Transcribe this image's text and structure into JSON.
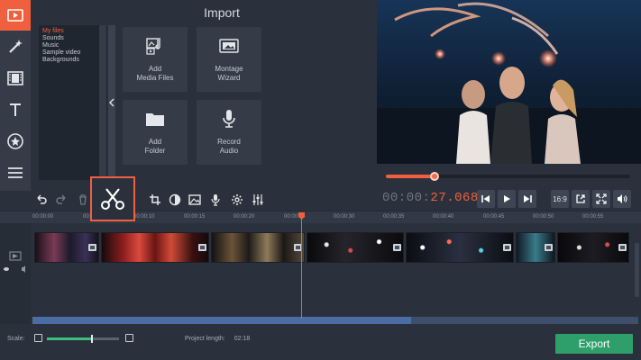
{
  "left_toolbar": [
    {
      "name": "import-video-icon"
    },
    {
      "name": "magic-wand-icon"
    },
    {
      "name": "filmstrip-icon"
    },
    {
      "name": "text-icon"
    },
    {
      "name": "star-badge-icon"
    },
    {
      "name": "list-icon"
    }
  ],
  "import": {
    "title": "Import",
    "categories": [
      "My files",
      "Sounds",
      "Music",
      "Sample video",
      "Backgrounds"
    ],
    "selected_category": "My files",
    "tiles": [
      {
        "label": "Add\nMedia Files",
        "icon": "add-media-files-icon"
      },
      {
        "label": "Montage\nWizard",
        "icon": "montage-wizard-icon"
      },
      {
        "label": "Add\nFolder",
        "icon": "folder-icon"
      },
      {
        "label": "Record\nAudio",
        "icon": "microphone-icon"
      }
    ]
  },
  "player": {
    "progress": 0.2,
    "timecode_prefix": "00:00:",
    "timecode_value": "27.068",
    "aspect_label": "16:9"
  },
  "timeline": {
    "ticks": [
      "00:00:00",
      "00:00:05",
      "00:00:10",
      "00:00:15",
      "00:00:20",
      "00:00:25",
      "00:00:30",
      "00:00:35",
      "00:00:40",
      "00:00:45",
      "00:00:50",
      "00:00:55"
    ]
  },
  "footer": {
    "scale_label": "Scale:",
    "scale_value": 0.62,
    "project_length_label": "Project length:",
    "project_length_value": "02:18",
    "export_label": "Export"
  },
  "colors": {
    "accent": "#f0603f",
    "export_green": "#2e9e6b",
    "background": "#2b313c"
  }
}
